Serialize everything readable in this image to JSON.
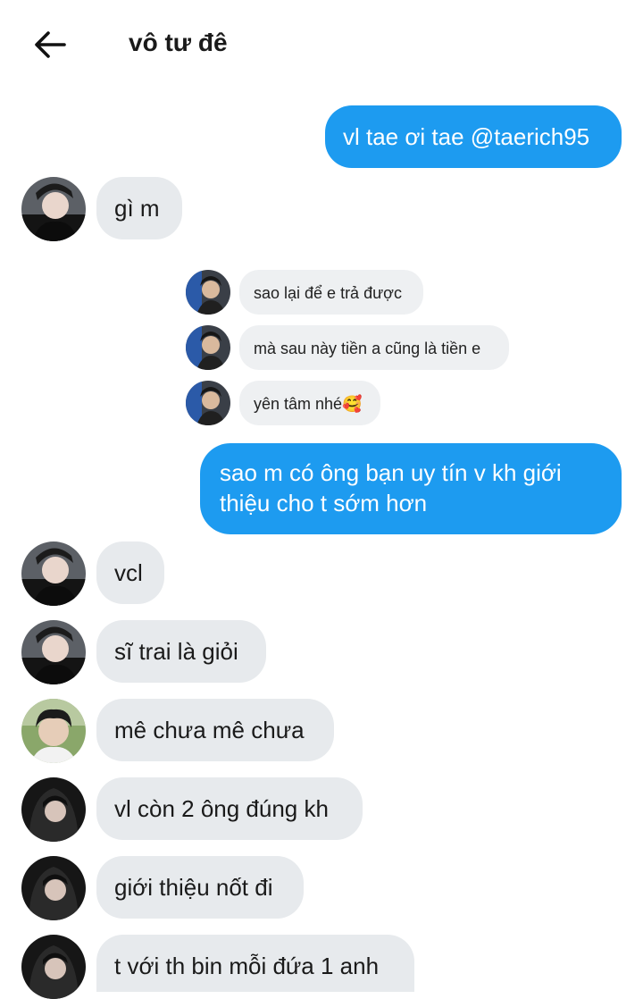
{
  "header": {
    "back_icon": "arrow-left-icon",
    "title": "vô tư đê"
  },
  "colors": {
    "outgoing_bubble": "#1d9bf0",
    "incoming_bubble": "#e7eaed",
    "quote_bubble": "#eef0f2"
  },
  "messages": [
    {
      "direction": "out",
      "text": "vl tae ơi tae @taerich95"
    },
    {
      "direction": "in",
      "avatar": "avatar-user-1",
      "text": "gì m"
    },
    {
      "direction": "quoted",
      "items": [
        {
          "avatar": "avatar-user-3",
          "text": "sao lại để e trả được"
        },
        {
          "avatar": "avatar-user-3",
          "text": "mà sau này tiền a cũng là tiền e"
        },
        {
          "avatar": "avatar-user-3",
          "text": "yên tâm nhé🥰"
        }
      ]
    },
    {
      "direction": "out",
      "text": "sao m có ông bạn uy tín v kh giới thiệu cho t sớm hơn"
    },
    {
      "direction": "in",
      "avatar": "avatar-user-1",
      "text": "vcl"
    },
    {
      "direction": "in",
      "avatar": "avatar-user-1",
      "text": "sĩ trai là giỏi"
    },
    {
      "direction": "in",
      "avatar": "avatar-user-2",
      "text": "mê chưa mê chưa"
    },
    {
      "direction": "in",
      "avatar": "avatar-user-4",
      "text": "vl còn 2 ông đúng kh"
    },
    {
      "direction": "in",
      "avatar": "avatar-user-4",
      "text": "giới thiệu nốt đi"
    },
    {
      "direction": "in",
      "avatar": "avatar-user-4",
      "text": "t với th bin mỗi đứa 1 anh"
    }
  ]
}
